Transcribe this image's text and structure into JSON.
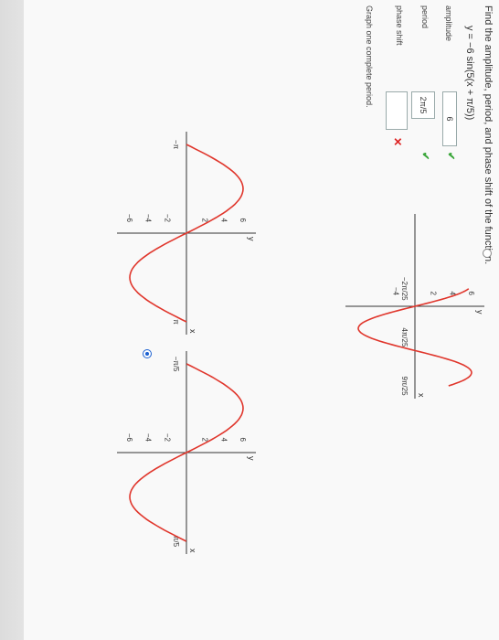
{
  "question": "Find the amplitude, period, and phase shift of the function.",
  "function": "y = −6 sin(5(x + π/5))",
  "fields": [
    {
      "label": "amplitude",
      "value": "6",
      "status": "correct"
    },
    {
      "label": "period",
      "value": "2π/5",
      "status": "correct"
    },
    {
      "label": "phase shift",
      "value": "",
      "status": "incorrect"
    }
  ],
  "graph_prompt": "Graph one complete period.",
  "status_marks": {
    "correct": "✔",
    "incorrect": "✕"
  },
  "colors": {
    "curve": "#e0362c",
    "check": "#3aa63a",
    "cross": "#d22222",
    "radio_selected": "#1a5fd0"
  },
  "chart_data": [
    {
      "type": "line",
      "option": "A",
      "selected": false,
      "x_ticks": [
        "−π",
        "π"
      ],
      "y_ticks": [
        "6",
        "4",
        "2",
        "−2",
        "−4",
        "−6"
      ],
      "xlabel": "x",
      "ylabel": "y",
      "xlim": [
        -3.14159,
        3.14159
      ],
      "ylim": [
        -6,
        6
      ],
      "series": [
        {
          "amplitude": 6,
          "period": 6.283,
          "phase": 0
        }
      ]
    },
    {
      "type": "line",
      "option": "B",
      "selected": true,
      "x_ticks": [
        "−π/5",
        "π/5"
      ],
      "y_ticks": [
        "6",
        "4",
        "2",
        "−2",
        "−4",
        "−6"
      ],
      "xlabel": "x",
      "ylabel": "y",
      "xlim": [
        -0.628,
        0.628
      ],
      "ylim": [
        -6,
        6
      ],
      "series": [
        {
          "amplitude": 6,
          "period": 1.257,
          "phase": 0
        }
      ]
    },
    {
      "type": "line",
      "option": "C",
      "selected": false,
      "x_ticks": [
        "−2π/25",
        "4π/25",
        "9π/25"
      ],
      "y_ticks": [
        "6",
        "4",
        "2",
        "−4"
      ],
      "xlabel": "x",
      "ylabel": "y",
      "xlim": [
        -0.25,
        1.13
      ],
      "ylim": [
        -6,
        6
      ],
      "series": [
        {
          "amplitude": 6,
          "period": 1.257,
          "phase": 0
        }
      ]
    },
    {
      "type": "line",
      "option": "D",
      "selected": false,
      "x_ticks": [
        "−π/5",
        "π/5"
      ],
      "y_ticks": [
        "6",
        "4",
        "2",
        "−2",
        "−4",
        "−6"
      ],
      "xlabel": "x",
      "ylabel": "y",
      "xlim": [
        -0.628,
        0.628
      ],
      "ylim": [
        -6,
        6
      ],
      "series": [
        {
          "amplitude": 6,
          "period": 1.257,
          "phase": 0
        }
      ]
    }
  ]
}
